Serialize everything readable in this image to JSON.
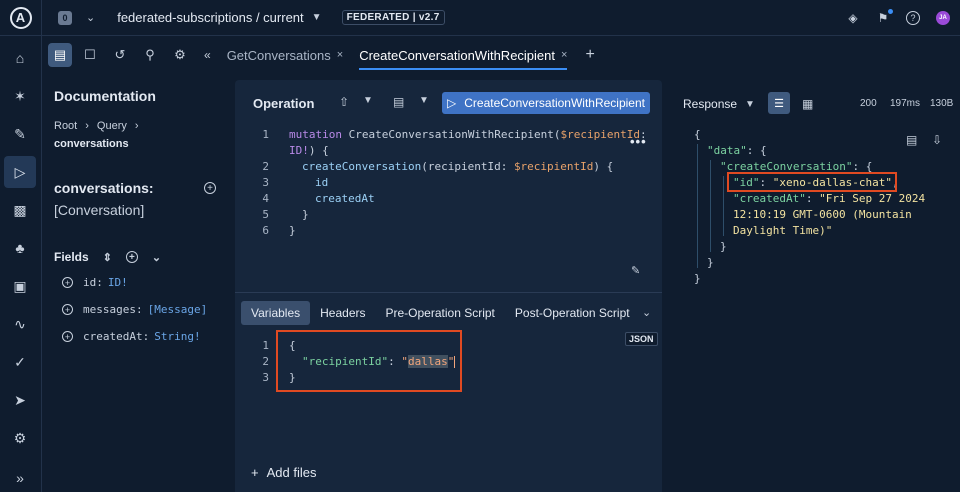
{
  "topbar": {
    "logo": "A",
    "org_badge": "0",
    "graph_name": "federated-subscriptions / current",
    "federation_badge": "FEDERATED | v2.7",
    "avatar": "JA"
  },
  "toolbar": {
    "tabs": [
      {
        "label": "GetConversations",
        "close": "×"
      },
      {
        "label": "CreateConversationWithRecipient",
        "close": "×"
      }
    ],
    "add_tab": "+"
  },
  "docs": {
    "title": "Documentation",
    "breadcrumb": [
      "Root",
      "Query"
    ],
    "breadcrumb_current": "conversations",
    "field_name": "conversations:",
    "field_type": "[Conversation]",
    "fields_label": "Fields",
    "fields": [
      {
        "name": "id:",
        "type": "ID!"
      },
      {
        "name": "messages:",
        "type": "[Message]"
      },
      {
        "name": "createdAt:",
        "type": "String!"
      }
    ]
  },
  "operation": {
    "title": "Operation",
    "run_label": "CreateConversationWithRecipient",
    "line_numbers": [
      "1",
      "2",
      "3",
      "4",
      "5",
      "6"
    ],
    "line1_kw": "mutation",
    "line1_name": " CreateConversationWithRecipient(",
    "line1_var": "$recipientId",
    "line1_colon": ":",
    "line1b_type": "ID!",
    "line1b_rest": ") {",
    "line2_fn": "createConversation",
    "line2_arg": "(recipientId: ",
    "line2_var": "$recipientId",
    "line2_end": ") {",
    "line3_field": "id",
    "line4_field": "createdAt",
    "line5": "}",
    "line6": "}",
    "more": "•••"
  },
  "variables": {
    "tabs": [
      "Variables",
      "Headers",
      "Pre-Operation Script",
      "Post-Operation Script"
    ],
    "json_badge": "JSON",
    "line_numbers": [
      "1",
      "2",
      "3"
    ],
    "open": "{",
    "key": "\"recipientId\"",
    "colon": ": ",
    "value_quote": "\"",
    "value": "dallas",
    "close": "}",
    "add_files": "Add files"
  },
  "response": {
    "label": "Response",
    "status": "200",
    "time": "197ms",
    "size": "130B",
    "l1": "{",
    "l2_key": "\"data\"",
    "l2_rest": ": {",
    "l3_key": "\"createConversation\"",
    "l3_rest": ": {",
    "l4_key": "\"id\"",
    "l4_colon": ": ",
    "l4_val": "\"xeno-dallas-chat\"",
    "l4_end": ",",
    "l5_key": "\"createdAt\"",
    "l5_colon": ": ",
    "l5_val": "\"Fri Sep 27 2024",
    "l6_val": "12:10:19 GMT-0600 (Mountain",
    "l7_val": "Daylight Time)\"",
    "l8": "}",
    "l9": "}",
    "l10": "}"
  }
}
